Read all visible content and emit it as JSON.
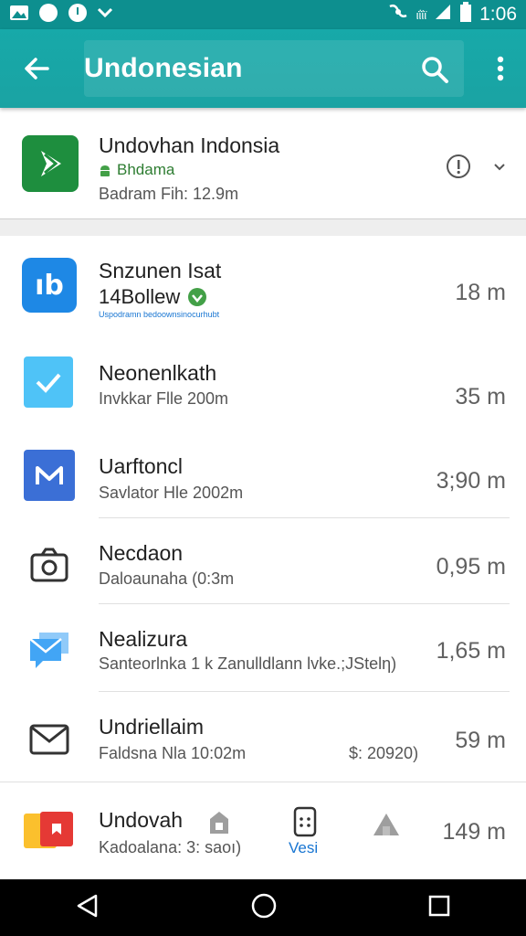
{
  "status_bar": {
    "time": "1:06",
    "network_label": "ιΐίϊ"
  },
  "toolbar": {
    "title": "Undonesian"
  },
  "top_app": {
    "name": "Undovhan Indonsia",
    "developer": "Bhdama",
    "info": "Badram Fih: 12.9m"
  },
  "items": [
    {
      "name": "Snzunen Isat",
      "sub": "14Bollew",
      "note": "Uspodramn bedoownsinocurhubt",
      "size": "18 m"
    },
    {
      "name": "Neonenlkath",
      "sub": "Invkkar Flle 200m",
      "size": "35 m"
    },
    {
      "name": "Uarftoncl",
      "sub": "Savlator Hle 2002m",
      "size": "3;90 m"
    },
    {
      "name": "Necdaon",
      "sub": "Daloaunaha (0:3m",
      "size": "0,95 m"
    },
    {
      "name": "Nealizura",
      "sub": "Santeorlnka 1 k Zanulldlann lvke.;JStelη)",
      "size": "1,65 m"
    },
    {
      "name": "Undriellaim",
      "sub": "Faldsna Nla 10:02m",
      "extra": "$: 20920)",
      "size": "59 m"
    },
    {
      "name": "Undovah",
      "sub": "Kadoalana: 3: saoı)",
      "bottom_label": "Vesi",
      "size": "149 m"
    }
  ]
}
